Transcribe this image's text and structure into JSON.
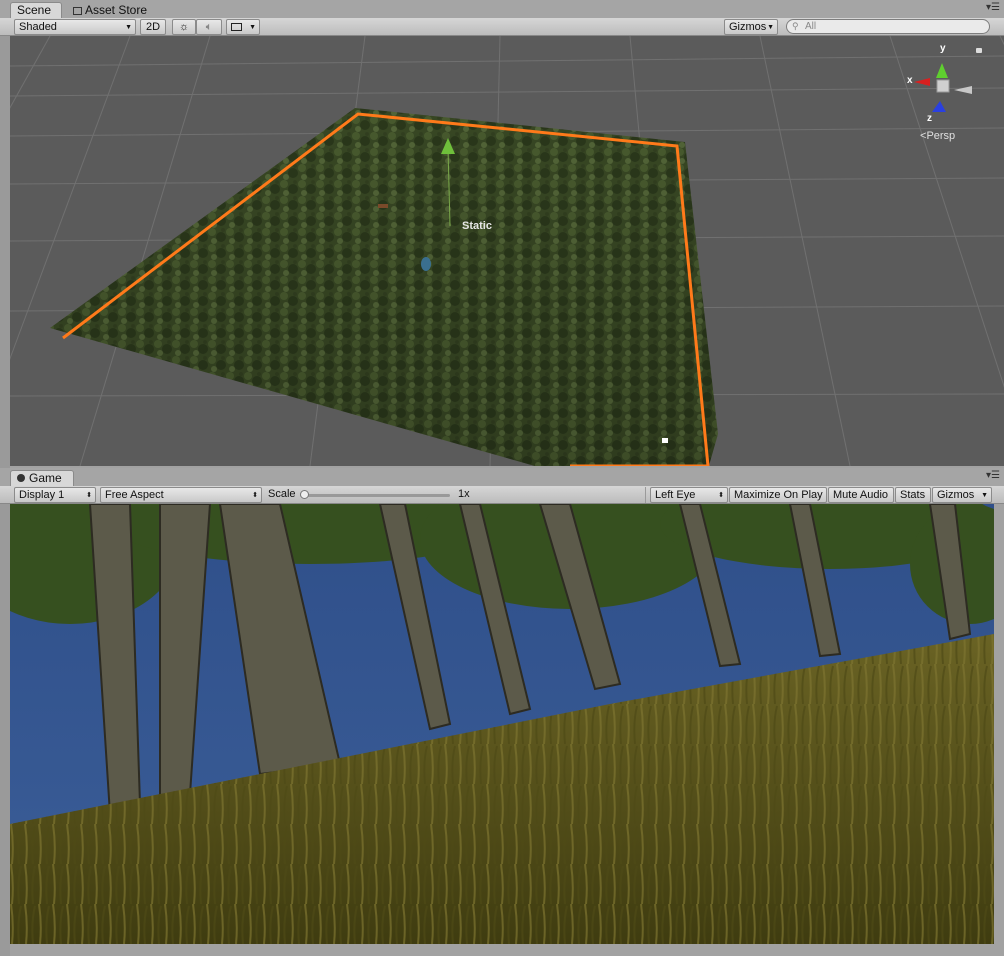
{
  "scene": {
    "tabs": [
      {
        "label": "Scene",
        "icon": "scene-icon"
      },
      {
        "label": "Asset Store",
        "icon": "store-icon"
      }
    ],
    "toolbar": {
      "shading_mode": "Shaded",
      "mode_2d": "2D",
      "gizmos": "Gizmos",
      "search_placeholder": "All"
    },
    "overlay_label": "Static",
    "gizmo_axes": {
      "x": "x",
      "y": "y",
      "z": "z"
    },
    "projection": "Persp",
    "colors": {
      "selection_outline": "#ff7a1a",
      "grid_bg": "#5a5a5a"
    }
  },
  "game": {
    "tab": {
      "label": "Game",
      "icon": "game-icon"
    },
    "toolbar": {
      "display": "Display 1",
      "aspect": "Free Aspect",
      "scale_label": "Scale",
      "scale_value": "1x",
      "eye": "Left Eye",
      "maximize": "Maximize On Play",
      "mute": "Mute Audio",
      "stats": "Stats",
      "gizmos": "Gizmos"
    },
    "colors": {
      "sky": "#34558f",
      "grass": "#5d5a1c"
    }
  }
}
